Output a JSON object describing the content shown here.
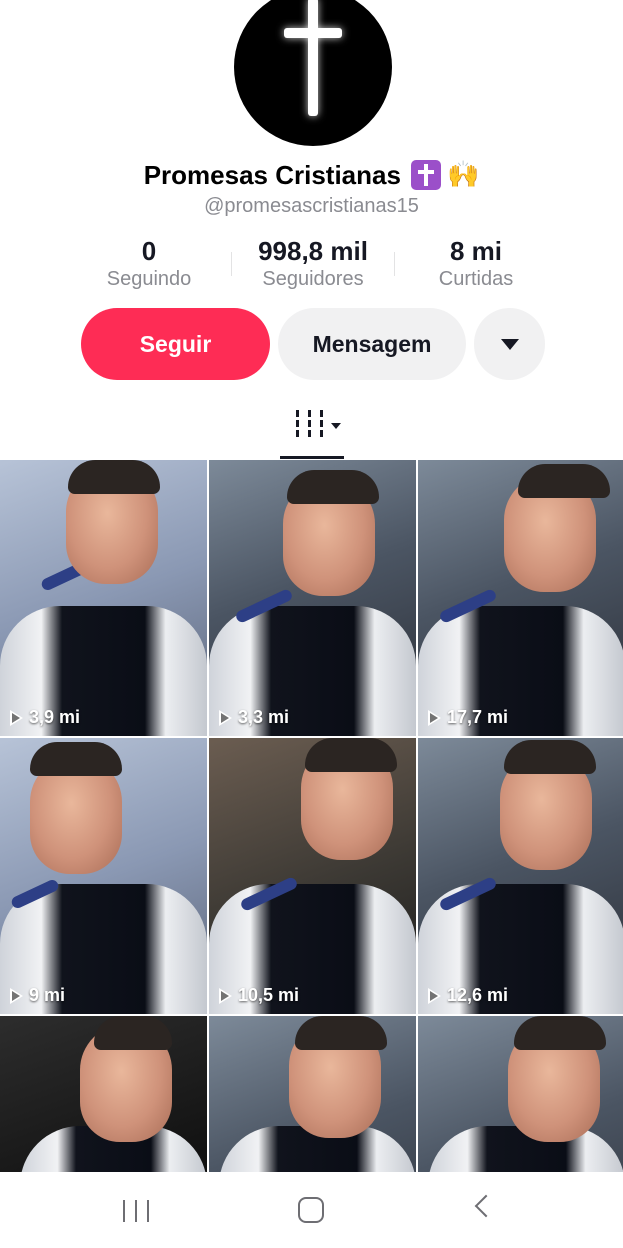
{
  "profile": {
    "name": "Promesas Cristianas",
    "emoji_hands": "🙌",
    "handle": "@promesascristianas15"
  },
  "stats": [
    {
      "value": "0",
      "label": "Seguindo"
    },
    {
      "value": "998,8 mil",
      "label": "Seguidores"
    },
    {
      "value": "8 mi",
      "label": "Curtidas"
    }
  ],
  "actions": {
    "follow_label": "Seguir",
    "message_label": "Mensagem"
  },
  "videos": [
    {
      "views": "3,9 mi"
    },
    {
      "views": "3,3 mi"
    },
    {
      "views": "17,7 mi"
    },
    {
      "views": "9 mi"
    },
    {
      "views": "10,5 mi"
    },
    {
      "views": "12,6 mi"
    },
    {
      "views": ""
    },
    {
      "views": ""
    },
    {
      "views": ""
    }
  ],
  "colors": {
    "follow": "#fe2c55",
    "secondary_button": "#f1f1f2",
    "muted_text": "#8a8b91"
  }
}
